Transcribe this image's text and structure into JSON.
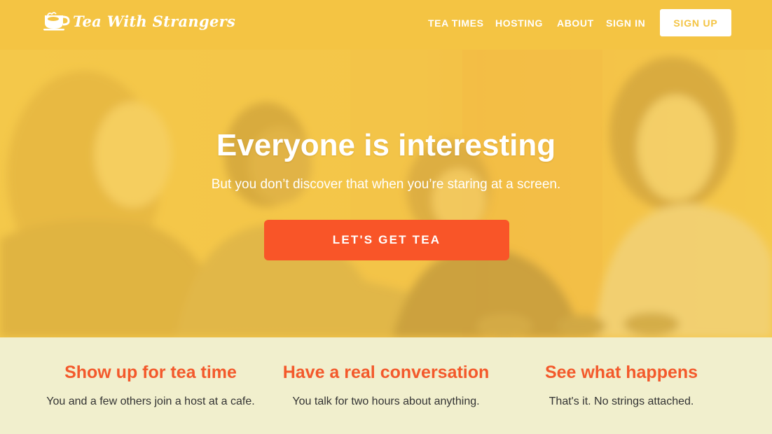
{
  "header": {
    "logo_text": "Tea With Strangers",
    "logo_icon": "teacup-icon",
    "nav": [
      {
        "label": "TEA TIMES"
      },
      {
        "label": "HOSTING"
      },
      {
        "label": "ABOUT"
      },
      {
        "label": "SIGN IN"
      }
    ],
    "signup_label": "SIGN UP"
  },
  "hero": {
    "title": "Everyone is interesting",
    "subtitle": "But you don’t discover that when you’re staring at a screen.",
    "cta_label": "LET'S GET TEA"
  },
  "features": [
    {
      "title": "Show up for tea time",
      "description": "You and a few others join a host at a cafe."
    },
    {
      "title": "Have a real conversation",
      "description": "You talk for two hours about anything."
    },
    {
      "title": "See what happens",
      "description": "That's it. No strings attached."
    }
  ],
  "colors": {
    "brand_yellow": "#f4c443",
    "cta_orange": "#f95528",
    "feature_title": "#f3592b",
    "feature_bg": "#f1efcd"
  }
}
